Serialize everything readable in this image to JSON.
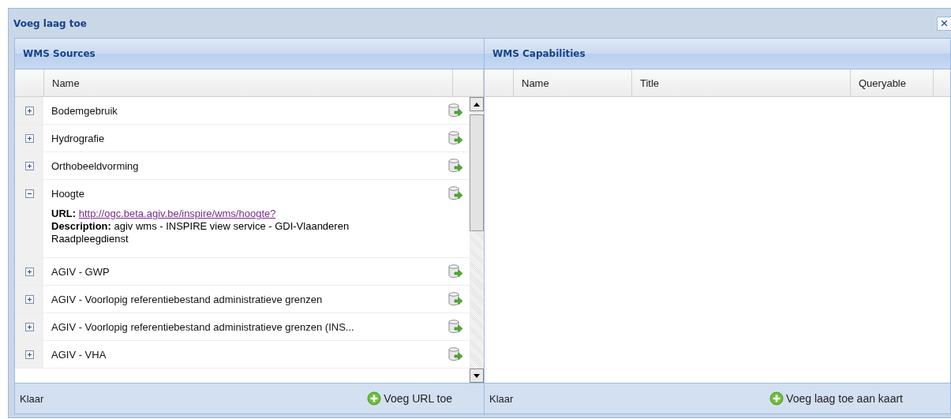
{
  "window": {
    "title": "Voeg laag toe",
    "close": "×"
  },
  "sources": {
    "title": "WMS Sources",
    "columns": [
      "Name"
    ],
    "rows": [
      {
        "name": "Bodemgebruik",
        "expanded": false
      },
      {
        "name": "Hydrografie",
        "expanded": false
      },
      {
        "name": "Orthobeeldvorming",
        "expanded": false
      },
      {
        "name": "Hoogte",
        "expanded": true,
        "url_label": "URL:",
        "url": "http://ogc.beta.agiv.be/inspire/wms/hoogte?",
        "description_label": "Description:",
        "description": "agiv wms - INSPIRE view service - GDI-Vlaanderen Raadpleegdienst"
      },
      {
        "name": "AGIV - GWP",
        "expanded": false
      },
      {
        "name": "AGIV - Voorlopig referentiebestand administratieve grenzen",
        "expanded": false
      },
      {
        "name": "AGIV - Voorlopig referentiebestand administratieve grenzen (INS...",
        "expanded": false
      },
      {
        "name": "AGIV - VHA",
        "expanded": false
      }
    ],
    "status": "Klaar",
    "button": "Voeg URL toe"
  },
  "capabilities": {
    "title": "WMS Capabilities",
    "columns": [
      "Name",
      "Title",
      "Queryable"
    ],
    "status": "Klaar",
    "button": "Voeg laag toe aan kaart"
  }
}
